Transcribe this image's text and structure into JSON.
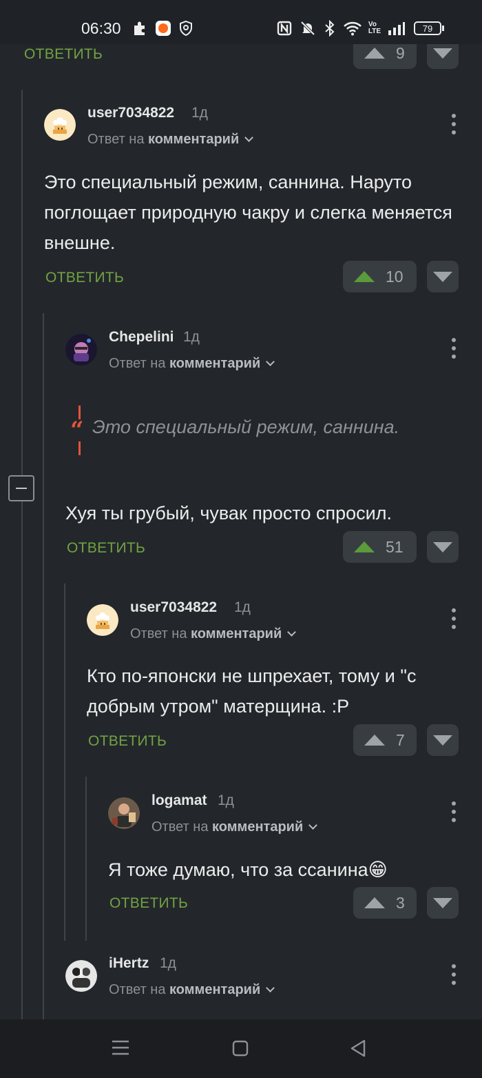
{
  "status_bar": {
    "time": "06:30",
    "battery": "79",
    "icons": [
      "puzzle-icon",
      "app-icon",
      "shield-icon",
      "nfc-icon",
      "mute-icon",
      "bluetooth-icon",
      "wifi-icon",
      "volte-icon",
      "signal-icon",
      "battery-icon"
    ]
  },
  "actions": {
    "reply_label": "ОТВЕТИТЬ",
    "reply_to_prefix": "Ответ на",
    "reply_to_target": "комментарий"
  },
  "top_partial": {
    "votes": "9"
  },
  "comments": [
    {
      "user": "user7034822",
      "ago": "1д",
      "text": "Это специальный режим, саннина. Наруто поглощает природную чакру и слегка меняется внешне.",
      "votes": "10"
    },
    {
      "user": "Chepelini",
      "ago": "1д",
      "quote": "Это специальный режим, саннина.",
      "text": "Хуя ты грубый, чувак просто спросил.",
      "votes": "51"
    },
    {
      "user": "user7034822",
      "ago": "1д",
      "text": "Кто по-японски не шпрехает, тому и \"с добрым утром\" матерщина. :P",
      "votes": "7"
    },
    {
      "user": "logamat",
      "ago": "1д",
      "text": "Я тоже думаю, что за ссанина😁",
      "votes": "3"
    },
    {
      "user": "iHertz",
      "ago": "1д"
    }
  ],
  "colors": {
    "background": "#23272b",
    "accent_green": "#72a243",
    "quote_red": "#e5533c"
  }
}
